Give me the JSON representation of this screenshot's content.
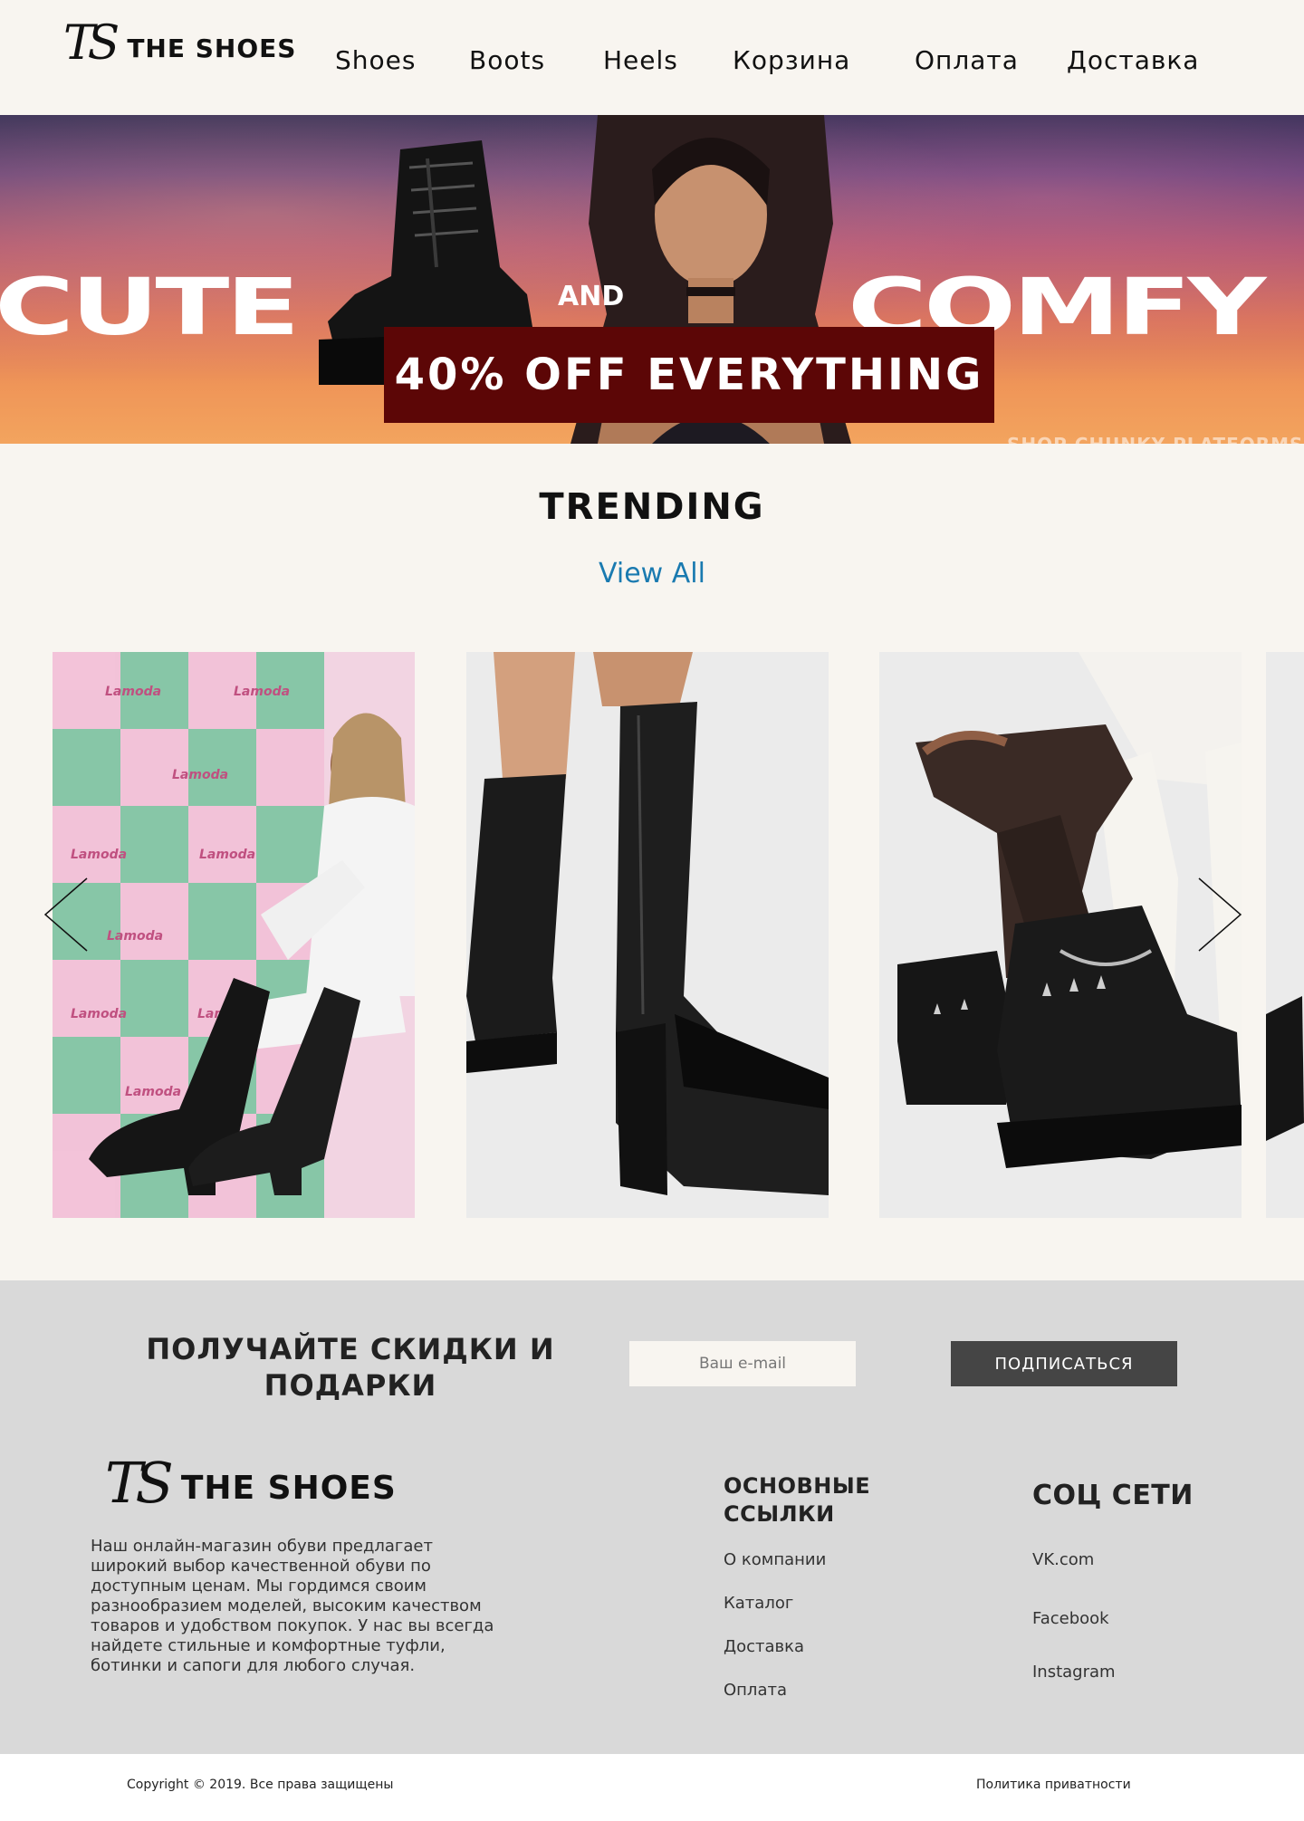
{
  "header": {
    "logo_mark": "TS",
    "logo_text": "THE SHOES",
    "nav": [
      "Shoes",
      "Boots",
      "Heels",
      "Корзина",
      "Оплата",
      "Доставка"
    ]
  },
  "hero": {
    "word_left": "CUTE",
    "word_and": "AND",
    "word_right": "COMFY",
    "banner": "40% OFF EVERYTHING",
    "small_text": "SHOP CHUNKY PLATFORMS"
  },
  "trending": {
    "title": "TRENDING",
    "view_all": "View All",
    "prev_icon": "chevron-left-icon",
    "next_icon": "chevron-right-icon",
    "card_watermark": "Lamoda"
  },
  "subscribe": {
    "title": "ПОЛУЧАЙТЕ СКИДКИ И ПОДАРКИ",
    "email_placeholder": "Ваш e-mail",
    "button": "ПОДПИСАТЬСЯ"
  },
  "footer": {
    "logo_mark": "TS",
    "logo_text": "THE SHOES",
    "about": "Наш онлайн-магазин обуви предлагает широкий выбор качественной обуви по доступным ценам. Мы гордимся своим разнообразием моделей, высоким качеством товаров и удобством покупок. У нас вы всегда найдете стильные и комфортные туфли, ботинки и сапоги для любого случая.",
    "links_title": "ОСНОВНЫЕ ССЫЛКИ",
    "links": [
      "О компании",
      "Каталог",
      "Доставка",
      "Оплата"
    ],
    "social_title": "СОЦ СЕТИ",
    "social": [
      "VK.com",
      "Facebook",
      "Instagram"
    ]
  },
  "bottom": {
    "copyright": "Copyright © 2019. Все права защищены",
    "privacy": "Политика приватности"
  },
  "colors": {
    "page_bg": "#f8f5f0",
    "banner_bg": "#5c0606",
    "link_blue": "#1a7ab0",
    "footer_bg": "#d9d9d9",
    "button_bg": "#454545"
  }
}
